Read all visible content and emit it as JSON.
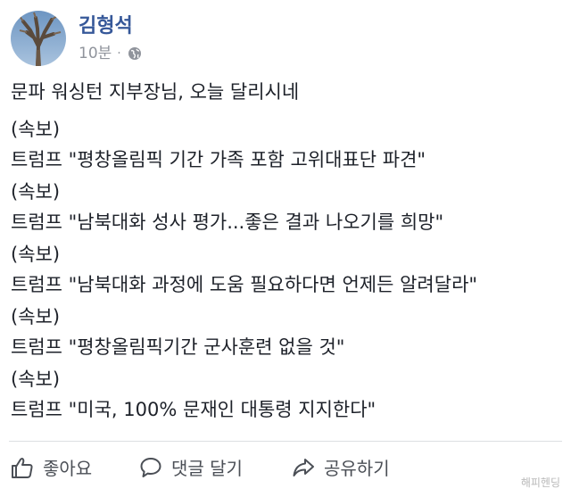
{
  "post": {
    "author": "김형석",
    "time": "10분",
    "separator": "·",
    "lines": [
      "문파 워싱턴 지부장님, 오늘 달리시네",
      "(속보)",
      "트럼프 \"평창올림픽 기간 가족 포함 고위대표단 파견\"",
      "(속보)",
      "트럼프 \"남북대화 성사 평가...좋은 결과 나오기를 희망\"",
      "(속보)",
      "트럼프 \"남북대화 과정에 도움 필요하다면 언제든 알려달라\"",
      "(속보)",
      "트럼프 \"평창올림픽기간 군사훈련 없을 것\"",
      "(속보)",
      "트럼프 \"미국, 100% 문재인 대통령 지지한다\""
    ]
  },
  "actions": {
    "like": "좋아요",
    "comment": "댓글 달기",
    "share": "공유하기"
  },
  "watermark": "해피헨딩",
  "colors": {
    "author": "#365899",
    "text": "#1d2129",
    "meta": "#90949c",
    "action": "#4b4f56"
  },
  "icons": [
    "avatar-tree",
    "globe-icon",
    "thumbs-up-icon",
    "comment-icon",
    "share-icon"
  ]
}
